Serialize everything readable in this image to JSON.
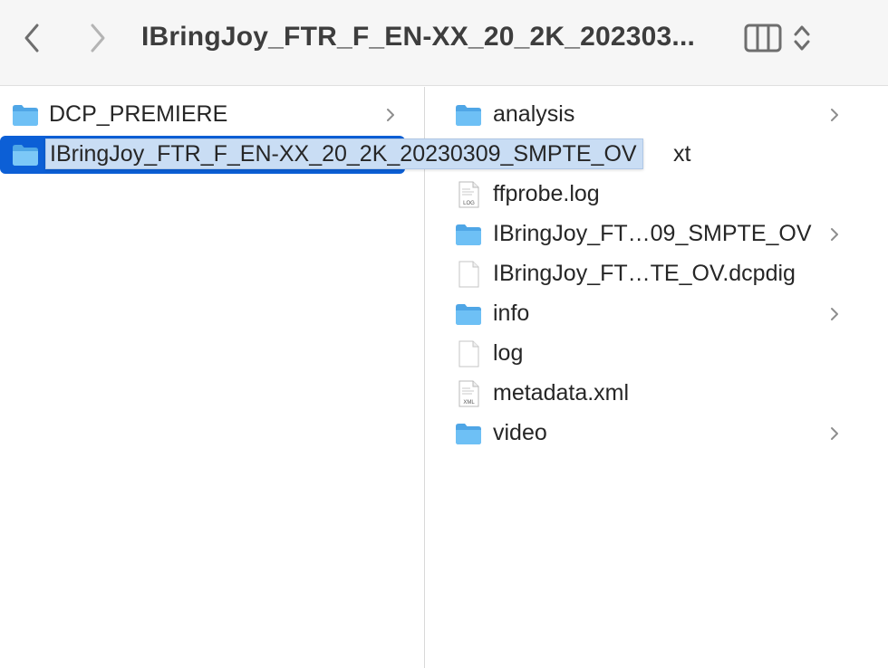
{
  "toolbar": {
    "title": "IBringJoy_FTR_F_EN-XX_20_2K_202303...",
    "back_icon": "chevron-left-icon",
    "forward_icon": "chevron-right-icon",
    "view_icon": "column-view-icon"
  },
  "column1": {
    "items": [
      {
        "name": "DCP_PREMIERE",
        "icon": "folder-icon",
        "has_children": true
      },
      {
        "name": "IBringJoy_FTR_F_EN-XX_20_2K_20230309_SMPTE_OV",
        "icon": "folder-icon",
        "selected": true,
        "editing": true
      }
    ]
  },
  "column2": {
    "items": [
      {
        "name": "analysis",
        "icon": "folder-icon",
        "has_children": true
      },
      {
        "name": "xt",
        "icon": "document-icon"
      },
      {
        "name": "ffprobe.log",
        "icon": "log-file-icon",
        "badge": "LOG"
      },
      {
        "name": "IBringJoy_FT…09_SMPTE_OV",
        "icon": "folder-icon",
        "has_children": true
      },
      {
        "name": "IBringJoy_FT…TE_OV.dcpdig",
        "icon": "document-icon"
      },
      {
        "name": "info",
        "icon": "folder-icon",
        "has_children": true
      },
      {
        "name": "log",
        "icon": "document-icon"
      },
      {
        "name": "metadata.xml",
        "icon": "xml-file-icon",
        "badge": "XML"
      },
      {
        "name": "video",
        "icon": "folder-icon",
        "has_children": true
      }
    ]
  },
  "colors": {
    "folder": "#5ab4ef",
    "selection": "#0c5fd6",
    "rename_field": "#c9ddf4"
  }
}
